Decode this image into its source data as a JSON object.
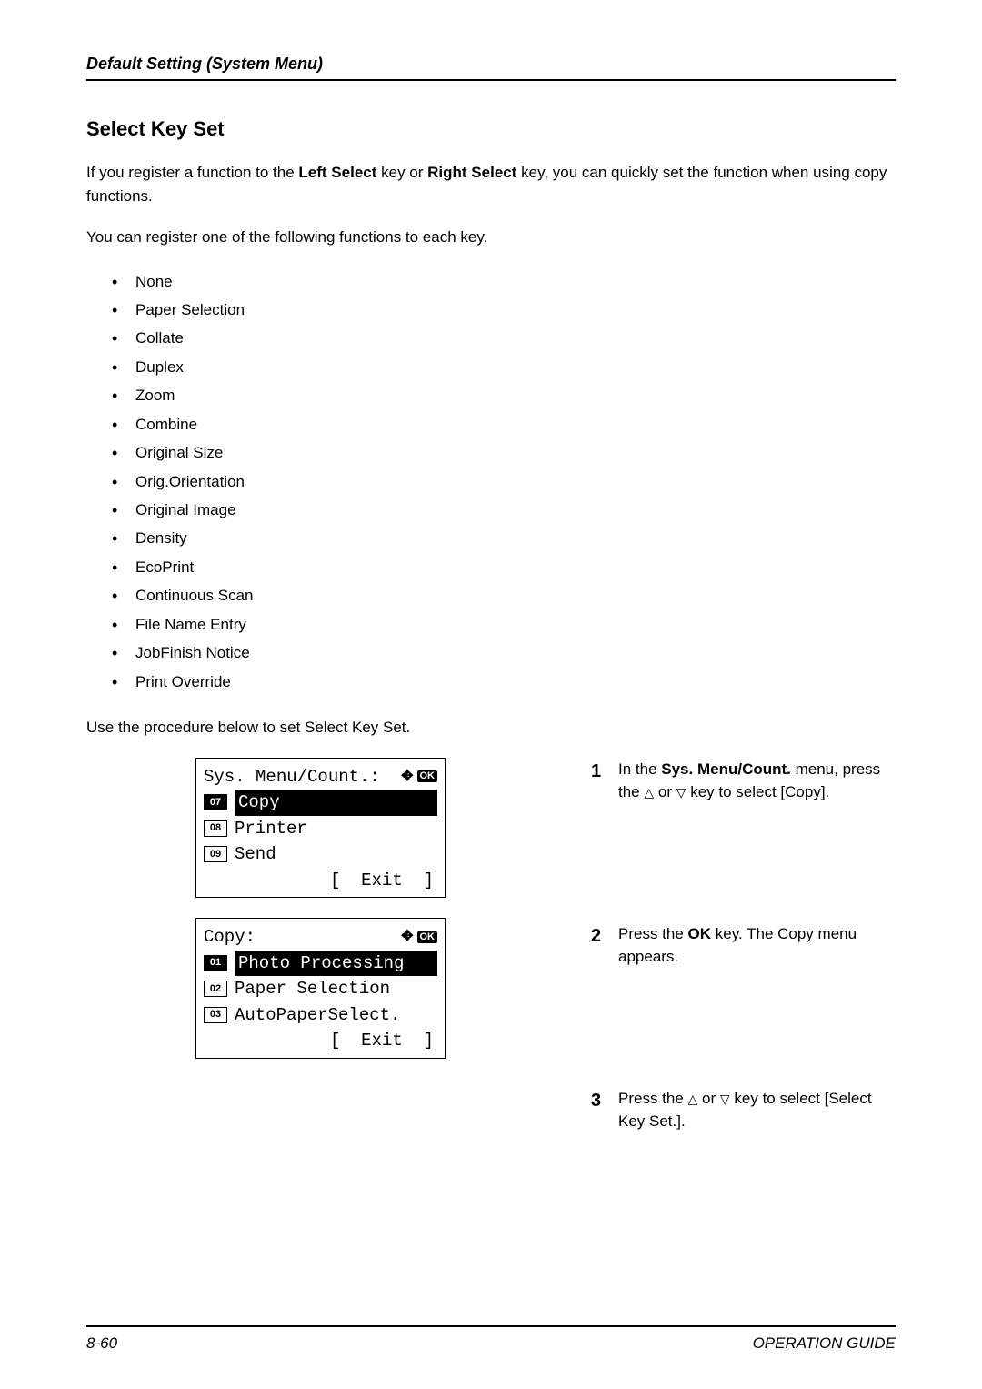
{
  "header": {
    "title": "Default Setting (System Menu)"
  },
  "section": {
    "title": "Select Key Set"
  },
  "intro": {
    "p1_a": "If you register a function to the ",
    "p1_b": "Left Select",
    "p1_c": " key or ",
    "p1_d": "Right Select",
    "p1_e": " key, you can quickly set the function when using copy functions.",
    "p2": "You can register one of the following functions to each key."
  },
  "functions": [
    "None",
    "Paper Selection",
    "Collate",
    "Duplex",
    "Zoom",
    "Combine",
    "Original Size",
    "Orig.Orientation",
    "Original Image",
    "Density",
    "EcoPrint",
    "Continuous Scan",
    "File Name Entry",
    "JobFinish Notice",
    "Print Override"
  ],
  "procedure_intro": "Use the procedure below to set Select Key Set.",
  "lcd1": {
    "title": "Sys. Menu/Count.:",
    "ok": "OK",
    "items": [
      {
        "num": "07",
        "text": "Copy",
        "hl": true
      },
      {
        "num": "08",
        "text": "Printer",
        "hl": false
      },
      {
        "num": "09",
        "text": "Send",
        "hl": false
      }
    ],
    "exit": "[  Exit  ]"
  },
  "lcd2": {
    "title": "Copy:",
    "ok": "OK",
    "items": [
      {
        "num": "01",
        "text": "Photo Processing",
        "hl": true
      },
      {
        "num": "02",
        "text": "Paper Selection",
        "hl": false
      },
      {
        "num": "03",
        "text": "AutoPaperSelect.",
        "hl": false
      }
    ],
    "exit": "[  Exit  ]"
  },
  "steps": {
    "s1": {
      "num": "1",
      "a": "In the ",
      "b": "Sys. Menu/Count.",
      "c": " menu, press the ",
      "d": " or ",
      "e": " key to select [Copy]."
    },
    "s2": {
      "num": "2",
      "a": "Press the ",
      "b": "OK",
      "c": " key. The Copy menu appears."
    },
    "s3": {
      "num": "3",
      "a": "Press the ",
      "b": " or ",
      "c": " key to select [Select Key Set.]."
    }
  },
  "footer": {
    "page": "8-60",
    "guide": "OPERATION GUIDE"
  }
}
